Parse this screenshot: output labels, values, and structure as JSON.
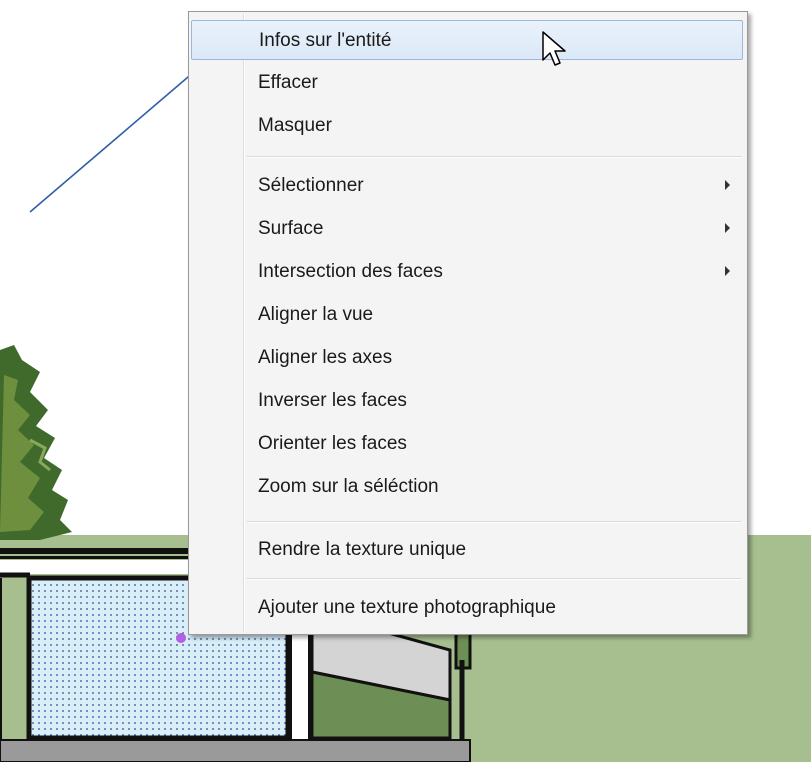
{
  "menu": {
    "items": [
      {
        "label": "Infos sur l'entité",
        "submenu": false,
        "highlighted": true
      },
      {
        "label": "Effacer",
        "submenu": false
      },
      {
        "label": "Masquer",
        "submenu": false
      },
      {
        "label": "Sélectionner",
        "submenu": true
      },
      {
        "label": "Surface",
        "submenu": true
      },
      {
        "label": "Intersection des faces",
        "submenu": true
      },
      {
        "label": "Aligner la vue",
        "submenu": false
      },
      {
        "label": "Aligner les axes",
        "submenu": false
      },
      {
        "label": "Inverser les faces",
        "submenu": false
      },
      {
        "label": "Orienter les faces",
        "submenu": false
      },
      {
        "label": "Zoom sur la séléction",
        "submenu": false
      },
      {
        "label": "Rendre la texture unique",
        "submenu": false
      },
      {
        "label": "Ajouter une texture photographique",
        "submenu": false
      }
    ]
  },
  "colors": {
    "grass": "#a7bf8f",
    "annotation_arrow": "#2f5fa8",
    "highlight": "#dbe8f7",
    "selection_dot": "#b060e0"
  },
  "icons": {
    "cursor": "mouse-pointer-icon",
    "submenu": "chevron-right-icon"
  }
}
